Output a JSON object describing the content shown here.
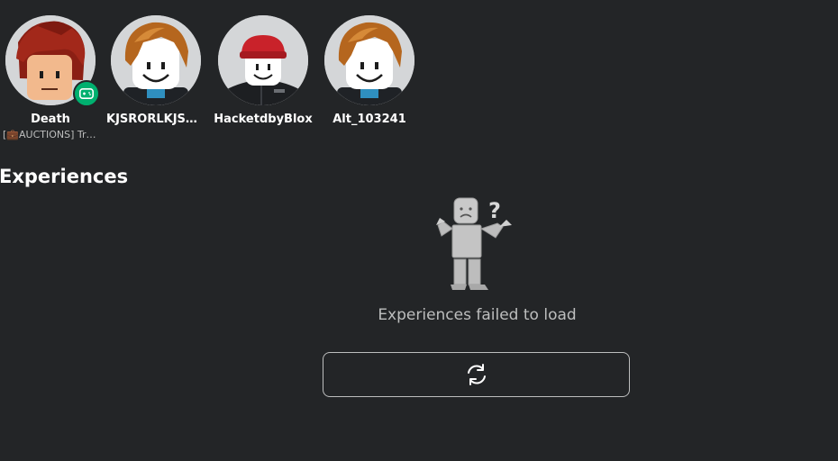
{
  "friends": [
    {
      "name": "Death",
      "status": "[💼AUCTIONS] Trade & Gold",
      "presence": "in-game",
      "avatar_icon": "avatar-red-hair"
    },
    {
      "name": "KJSRORLKJSDRK",
      "status": "",
      "presence": "offline",
      "avatar_icon": "avatar-bacon-hair"
    },
    {
      "name": "HacketdbyBlox",
      "status": "",
      "presence": "offline",
      "avatar_icon": "avatar-red-cap"
    },
    {
      "name": "Alt_103241",
      "status": "",
      "presence": "offline",
      "avatar_icon": "avatar-bacon-hair"
    }
  ],
  "experiences": {
    "title": "Experiences",
    "error_message": "Experiences failed to load",
    "retry_icon": "refresh-icon",
    "error_icon": "confused-robloxian-icon"
  },
  "colors": {
    "background": "#232527",
    "text_primary": "#ffffff",
    "text_secondary": "#bdbebe",
    "presence_ingame": "#00b06f"
  }
}
